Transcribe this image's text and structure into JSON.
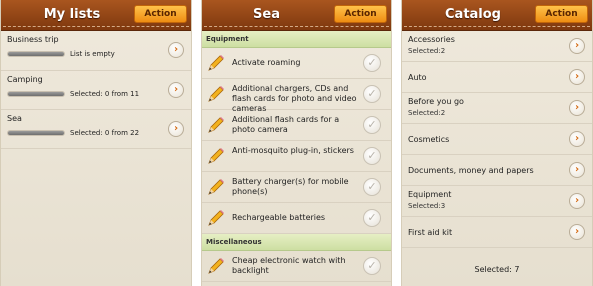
{
  "colors": {
    "header": "#8f4514",
    "action_button": "#f7a52b",
    "section_header": "#d7e6b3",
    "chevron": "#d46a12",
    "panel_bg": "#ece6d8"
  },
  "my_lists": {
    "title": "My lists",
    "action_label": "Action",
    "items": [
      {
        "name": "Business trip",
        "status": "List is empty",
        "progress_pct": 0
      },
      {
        "name": "Camping",
        "status": "Selected: 0 from 11",
        "progress_pct": 0
      },
      {
        "name": "Sea",
        "status": "Selected: 0 from 22",
        "progress_pct": 0
      }
    ],
    "chevron_icon": "chevron-right-icon"
  },
  "sea": {
    "title": "Sea",
    "action_label": "Action",
    "sections": [
      {
        "label": "Equipment",
        "items": [
          {
            "text": "Activate roaming",
            "checked": false
          },
          {
            "text": "Additional chargers, CDs and flash cards for photo and video cameras",
            "checked": false
          },
          {
            "text": "Additional flash cards for a photo camera",
            "checked": false
          },
          {
            "text": "Anti-mosquito plug-in, stickers",
            "checked": false
          },
          {
            "text": "Battery charger(s) for mobile phone(s)",
            "checked": false
          },
          {
            "text": "Rechargeable batteries",
            "checked": false
          }
        ]
      },
      {
        "label": "Miscellaneous",
        "items": [
          {
            "text": "Cheap electronic watch with backlight",
            "checked": false
          }
        ]
      }
    ],
    "item_icon": "pencil-icon",
    "check_icon": "checkmark-icon"
  },
  "catalog": {
    "title": "Catalog",
    "action_label": "Action",
    "items": [
      {
        "name": "Accessories",
        "sub": "Selected:2"
      },
      {
        "name": "Auto",
        "sub": ""
      },
      {
        "name": "Before you go",
        "sub": "Selected:2"
      },
      {
        "name": "Cosmetics",
        "sub": ""
      },
      {
        "name": "Documents, money and papers",
        "sub": ""
      },
      {
        "name": "Equipment",
        "sub": "Selected:3"
      },
      {
        "name": "First aid kit",
        "sub": ""
      }
    ],
    "footer": "Selected: 7"
  }
}
